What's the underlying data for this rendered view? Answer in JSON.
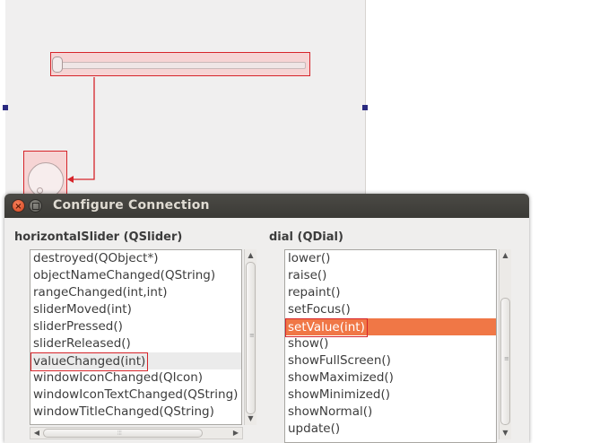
{
  "dialog": {
    "title": "Configure Connection",
    "close_glyph": "×"
  },
  "sender": {
    "label": "horizontalSlider (QSlider)",
    "signals": [
      {
        "text": "destroyed(QObject*)"
      },
      {
        "text": "objectNameChanged(QString)"
      },
      {
        "text": "rangeChanged(int,int)"
      },
      {
        "text": "sliderMoved(int)"
      },
      {
        "text": "sliderPressed()"
      },
      {
        "text": "sliderReleased()"
      },
      {
        "text": "valueChanged(int)",
        "state": "hover-framed"
      },
      {
        "text": "windowIconChanged(QIcon)"
      },
      {
        "text": "windowIconTextChanged(QString)"
      },
      {
        "text": "windowTitleChanged(QString)"
      }
    ]
  },
  "receiver": {
    "label": "dial (QDial)",
    "slots": [
      {
        "text": "lower()"
      },
      {
        "text": "raise()"
      },
      {
        "text": "repaint()"
      },
      {
        "text": "setFocus()"
      },
      {
        "text": "setValue(int)",
        "state": "selected-framed"
      },
      {
        "text": "show()"
      },
      {
        "text": "showFullScreen()"
      },
      {
        "text": "showMaximized()"
      },
      {
        "text": "showMinimized()"
      },
      {
        "text": "showNormal()"
      },
      {
        "text": "update()"
      }
    ]
  },
  "colors": {
    "selection": "#f07746",
    "highlight_frame": "#d6242a",
    "widget_fill": "#f6d4d4",
    "title_bar": "#3f3e3a"
  }
}
